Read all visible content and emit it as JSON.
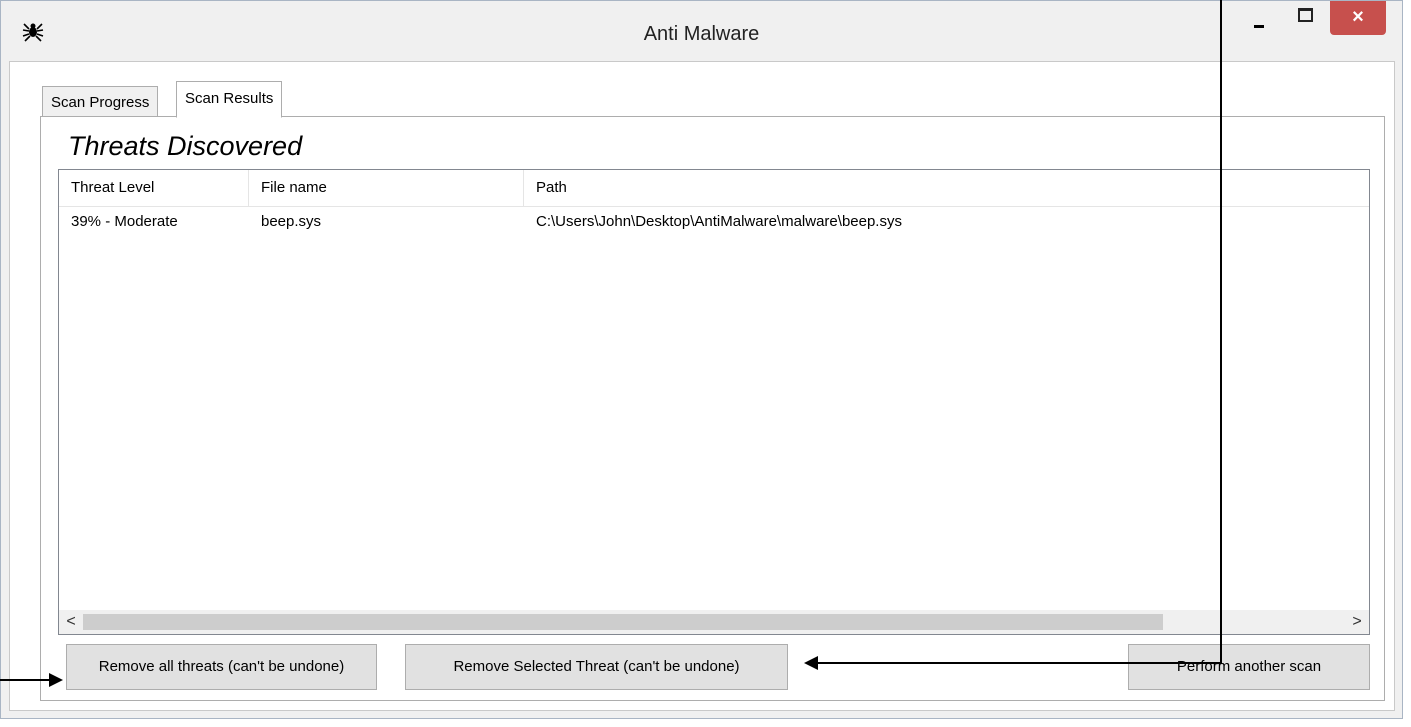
{
  "window": {
    "title": "Anti Malware",
    "close_symbol": "×",
    "icon": "spider-icon"
  },
  "tabs": [
    {
      "label": "Scan Progress"
    },
    {
      "label": "Scan Results"
    }
  ],
  "results": {
    "heading": "Threats Discovered",
    "columns": [
      "Threat Level",
      "File name",
      "Path"
    ],
    "rows": [
      {
        "threat_level": "39% - Moderate",
        "file_name": "beep.sys",
        "path": "C:\\Users\\John\\Desktop\\AntiMalware\\malware\\beep.sys"
      }
    ],
    "scroll_left": "<",
    "scroll_right": ">"
  },
  "buttons": {
    "remove_all": "Remove all threats (can't be undone)",
    "remove_selected": "Remove Selected Threat (can't be undone)",
    "another_scan": "Perform another scan"
  },
  "colors": {
    "close_button": "#c7504d",
    "window_bg": "#f0f0f0"
  }
}
